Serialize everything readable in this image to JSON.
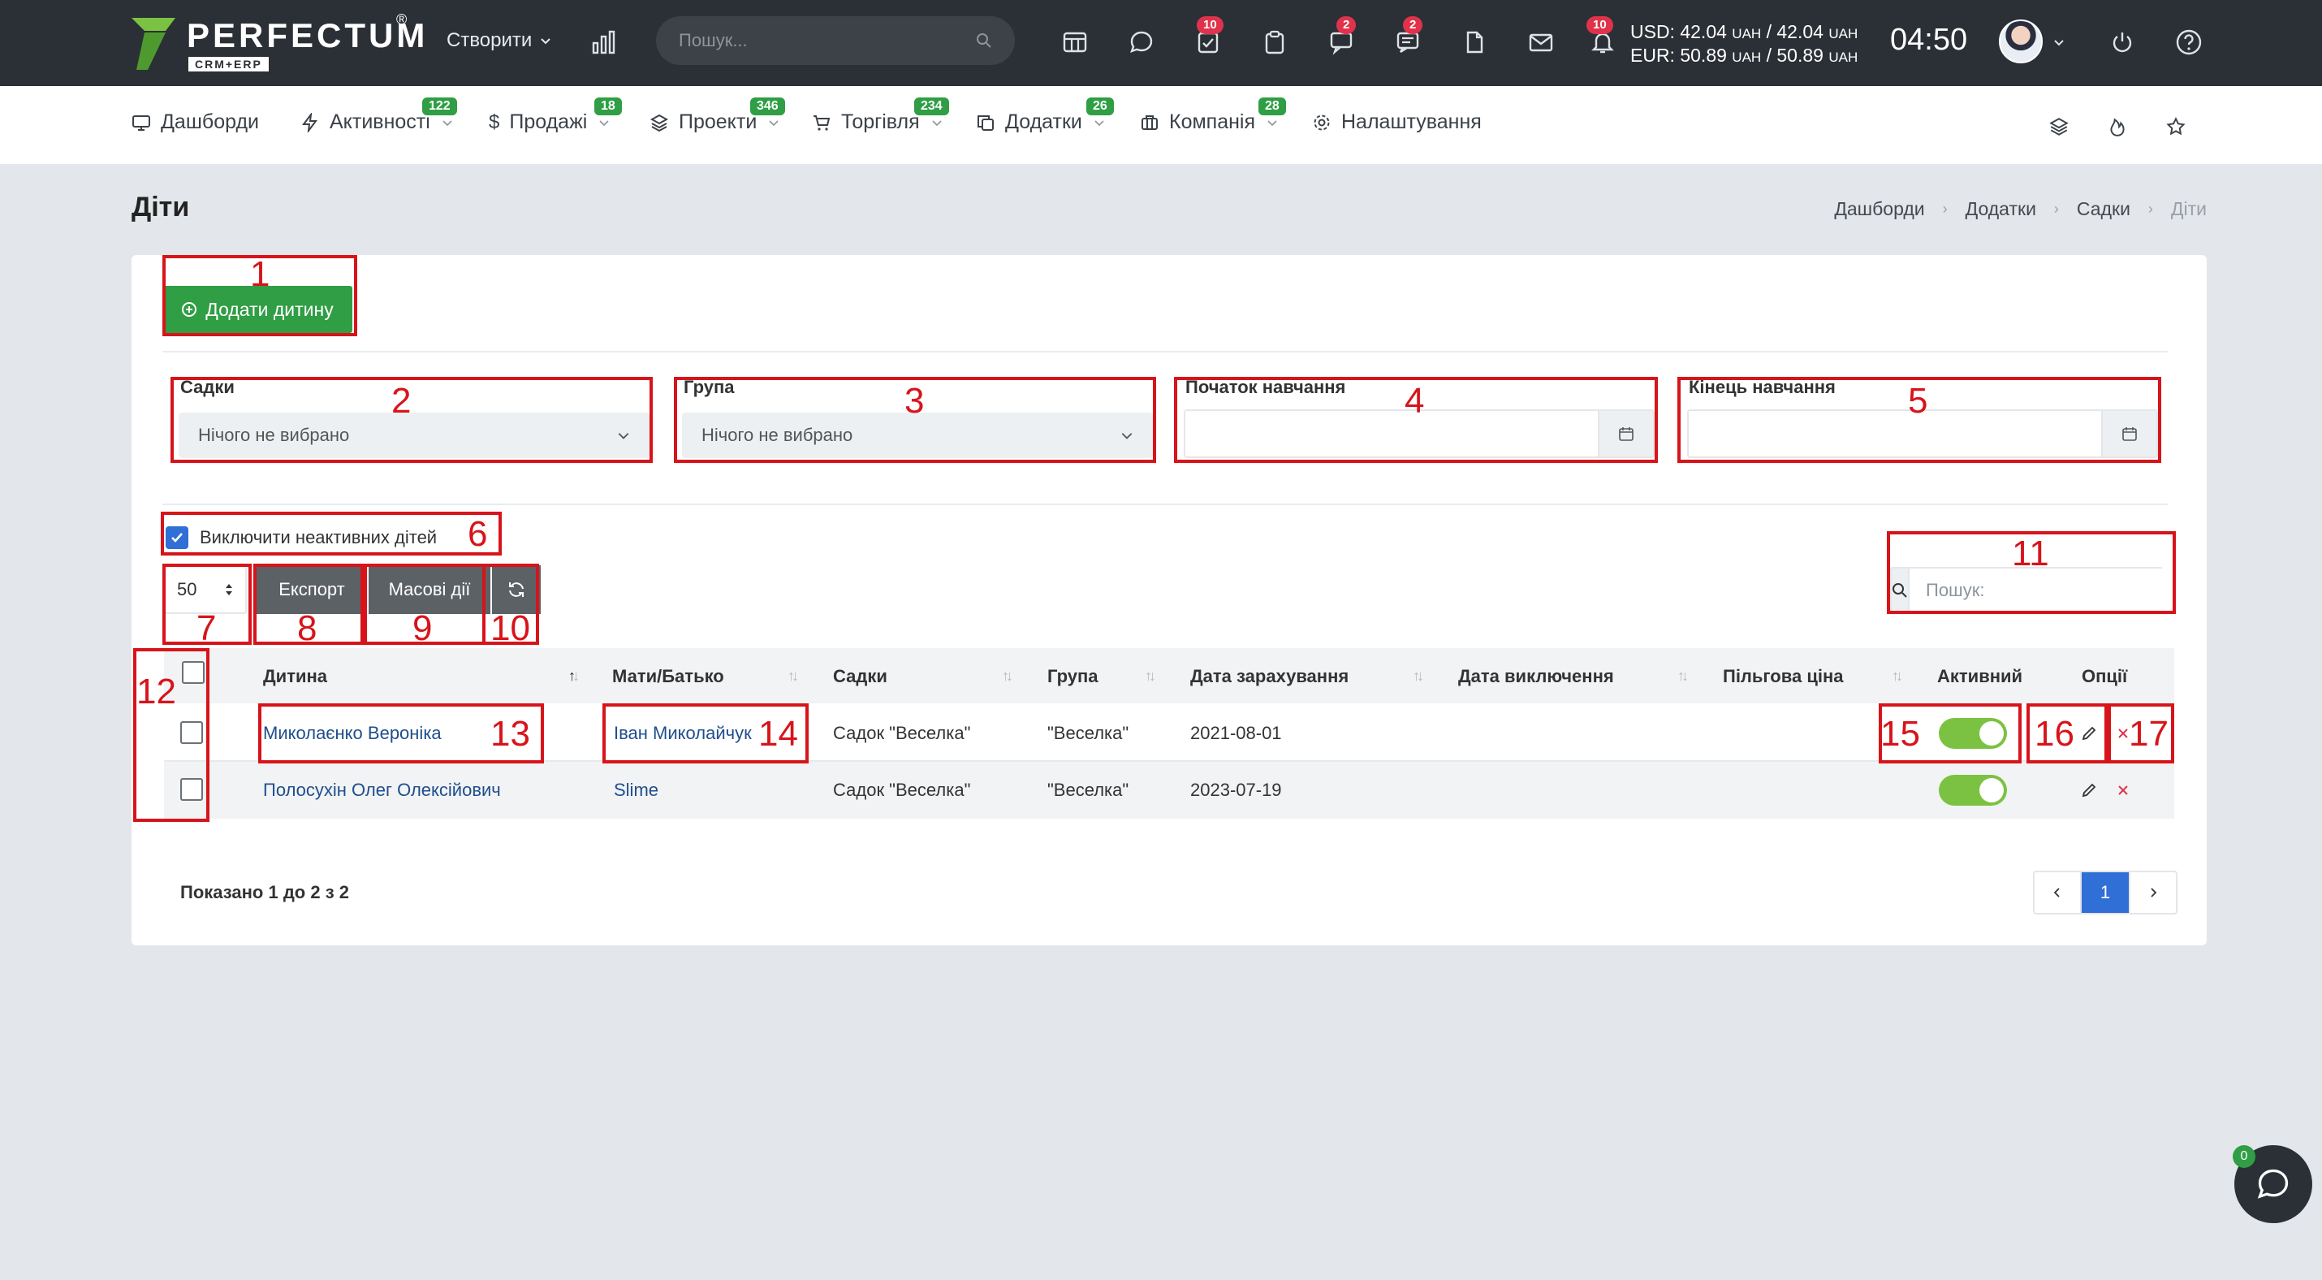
{
  "topbar": {
    "logo_text": "PERFECTUM",
    "logo_reg": "®",
    "logo_sub": "CRM+ERP",
    "create_label": "Створити",
    "search_placeholder": "Пошук...",
    "badges": {
      "tasks": "10",
      "chat": "2",
      "messages": "2",
      "notifications": "10"
    },
    "rates": {
      "usd_label": "USD: 42.04",
      "usd_unit": "UAH",
      "usd_sep": "/ 42.04",
      "usd_unit2": "UAH",
      "eur_label": "EUR: 50.89",
      "eur_unit": "UAH",
      "eur_sep": "/ 50.89",
      "eur_unit2": "UAH"
    },
    "clock": "04:50"
  },
  "nav": {
    "items": [
      {
        "label": "Дашборди",
        "badge": ""
      },
      {
        "label": "Активності",
        "badge": "122"
      },
      {
        "label": "Продажі",
        "badge": "18"
      },
      {
        "label": "Проекти",
        "badge": "346"
      },
      {
        "label": "Торгівля",
        "badge": "234"
      },
      {
        "label": "Додатки",
        "badge": "26"
      },
      {
        "label": "Компанія",
        "badge": "28"
      },
      {
        "label": "Налаштування",
        "badge": ""
      }
    ]
  },
  "page": {
    "title": "Діти",
    "breadcrumb": [
      "Дашборди",
      "Додатки",
      "Садки",
      "Діти"
    ]
  },
  "toolbar": {
    "add_label": "Додати дитину",
    "export_label": "Експорт",
    "bulk_label": "Масові дії",
    "per_page": "50",
    "search_placeholder": "Пошук:"
  },
  "filters": {
    "kindergartens_label": "Садки",
    "kindergartens_value": "Нічого не вибрано",
    "group_label": "Група",
    "group_value": "Нічого не вибрано",
    "start_label": "Початок навчання",
    "end_label": "Кінець навчання",
    "exclude_inactive_label": "Виключити неактивних дітей"
  },
  "table": {
    "columns": [
      "Дитина",
      "Мати/Батько",
      "Садки",
      "Група",
      "Дата зарахування",
      "Дата виключення",
      "Пільгова ціна",
      "Активний",
      "Опції"
    ],
    "rows": [
      {
        "child": "Миколаєнко Вероніка",
        "parent": "Іван Миколайчук",
        "kindergarten": "Садок \"Веселка\"",
        "group": "\"Веселка\"",
        "enrolled": "2021-08-01",
        "excluded": "",
        "discount": "",
        "active": true
      },
      {
        "child": "Полосухін Олег Олексійович",
        "parent": "Slime",
        "kindergarten": "Садок \"Веселка\"",
        "group": "\"Веселка\"",
        "enrolled": "2023-07-19",
        "excluded": "",
        "discount": "",
        "active": true
      }
    ],
    "shown_text": "Показано 1 до 2 з 2",
    "current_page": "1"
  },
  "annotations": [
    "1",
    "2",
    "3",
    "4",
    "5",
    "6",
    "7",
    "8",
    "9",
    "10",
    "11",
    "12",
    "13",
    "14",
    "15",
    "16",
    "17"
  ],
  "chat_badge": "0",
  "colors": {
    "accent_green": "#2f9e44",
    "primary_blue": "#2f6fd6",
    "annotation_red": "#d7141a",
    "topbar": "#2b3036"
  }
}
